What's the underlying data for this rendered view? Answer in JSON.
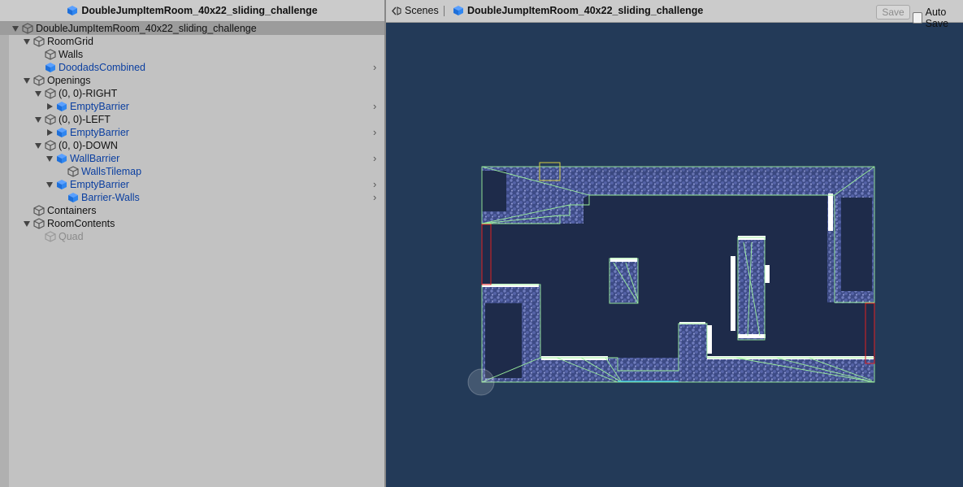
{
  "hierarchy": {
    "title": "DoubleJumpItemRoom_40x22_sliding_challenge",
    "items": [
      {
        "label": "DoubleJumpItemRoom_40x22_sliding_challenge",
        "kind": "go"
      },
      {
        "label": "RoomGrid",
        "kind": "go"
      },
      {
        "label": "Walls",
        "kind": "go"
      },
      {
        "label": "DoodadsCombined",
        "kind": "prefab"
      },
      {
        "label": "Openings",
        "kind": "go"
      },
      {
        "label": "(0, 0)-RIGHT",
        "kind": "go"
      },
      {
        "label": "EmptyBarrier",
        "kind": "prefab"
      },
      {
        "label": "(0, 0)-LEFT",
        "kind": "go"
      },
      {
        "label": "EmptyBarrier",
        "kind": "prefab"
      },
      {
        "label": "(0, 0)-DOWN",
        "kind": "go"
      },
      {
        "label": "WallBarrier",
        "kind": "prefab"
      },
      {
        "label": "WallsTilemap",
        "kind": "prefab-child"
      },
      {
        "label": "EmptyBarrier",
        "kind": "prefab"
      },
      {
        "label": "Barrier-Walls",
        "kind": "prefab-child"
      },
      {
        "label": "Containers",
        "kind": "go"
      },
      {
        "label": "RoomContents",
        "kind": "go"
      },
      {
        "label": "Quad",
        "kind": "disabled"
      }
    ]
  },
  "scene_toolbar": {
    "scenes_label": "Scenes",
    "prefab_title": "DoubleJumpItemRoom_40x22_sliding_challenge",
    "save_label": "Save",
    "auto_save_label": "Auto Save",
    "auto_save_checked": false
  },
  "colors": {
    "scene_background": "#233a58",
    "room_fill": "#1e2b4a",
    "tile_blue": "#4a5a9a",
    "tile_light": "#8a94c8",
    "collider_green": "#9cf09c",
    "opening_red": "#e02020",
    "selection_yellow": "#d8d040",
    "prefab_blue": "#0b3fa0"
  },
  "icons": {
    "gameobject": "cube-outline-icon",
    "prefab": "prefab-cube-icon",
    "scenes": "scenes-back-icon"
  }
}
